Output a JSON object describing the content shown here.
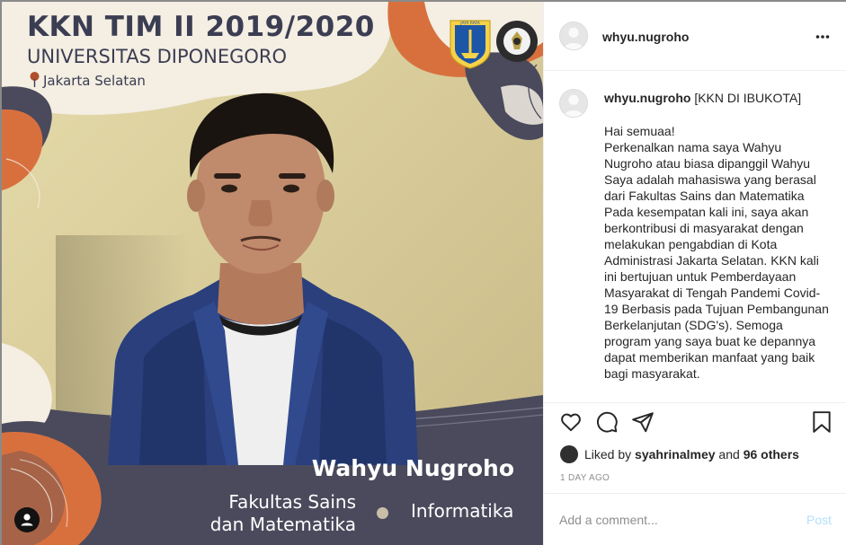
{
  "poster": {
    "title": "KKN TIM II 2019/2020",
    "university": "UNIVERSITAS DIPONEGORO",
    "location": "Jakarta Selatan",
    "logo_left_text": "JAYA RAYA",
    "name": "Wahyu Nugroho",
    "faculty": "Fakultas Sains dan Matematika",
    "major": "Informatika",
    "colors": {
      "navy": "#4a4a5c",
      "cream": "#f4eee3",
      "orange": "#d8703e",
      "wall": "#dccf9c"
    }
  },
  "header": {
    "username": "whyu.nugroho",
    "more_icon": "more-horizontal-icon"
  },
  "caption": {
    "username": "whyu.nugroho",
    "headline": " [KKN DI IBUKOTA]",
    "body": "Hai semuaa!\nPerkenalkan nama saya Wahyu Nugroho atau biasa dipanggil Wahyu Saya adalah mahasiswa yang berasal dari Fakultas Sains dan Matematika Pada kesempatan kali ini, saya akan berkontribusi di masyarakat dengan melakukan pengabdian di Kota Administrasi Jakarta Selatan. KKN kali ini bertujuan untuk Pemberdayaan Masyarakat di Tengah Pandemi Covid-19 Berbasis pada Tujuan Pembangunan Berkelanjutan (SDG's). Semoga program yang saya buat ke depannya dapat memberikan manfaat yang baik bagi masyarakat."
  },
  "actions": {
    "icons": [
      "heart-icon",
      "comment-icon",
      "share-icon",
      "bookmark-icon"
    ]
  },
  "likes": {
    "prefix": "Liked by ",
    "user": "syahrinalmey",
    "middle": " and ",
    "others": "96 others"
  },
  "timestamp": "1 DAY AGO",
  "comment": {
    "placeholder": "Add a comment...",
    "post_label": "Post",
    "post_color": "#b2dffc"
  }
}
